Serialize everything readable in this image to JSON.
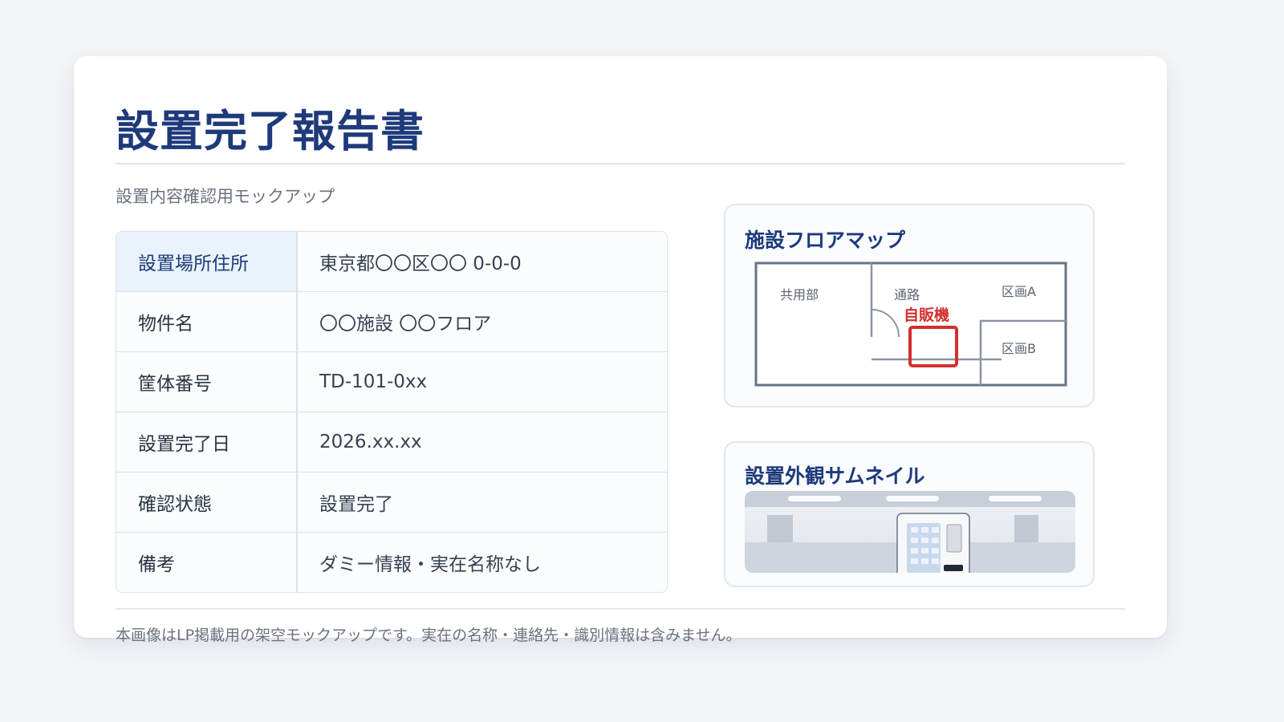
{
  "report": {
    "title": "設置完了報告書",
    "subtitle": "設置内容確認用モックアップ",
    "rows": [
      {
        "label": "設置場所住所",
        "value": "東京都〇〇区〇〇 0-0-0"
      },
      {
        "label": "物件名",
        "value": "〇〇施設 〇〇フロア"
      },
      {
        "label": "筐体番号",
        "value": "TD-101-0xx"
      },
      {
        "label": "設置完了日",
        "value": "2026.xx.xx"
      },
      {
        "label": "確認状態",
        "value": "設置完了"
      },
      {
        "label": "備考",
        "value": "ダミー情報・実在名称なし"
      }
    ]
  },
  "floor_map": {
    "title": "施設フロアマップ",
    "labels": {
      "common": "共用部",
      "aisle": "通路",
      "zone_a": "区画A",
      "zone_b": "区画B",
      "vending": "自販機"
    },
    "colors": {
      "wall": "#667386",
      "marker": "#d32f2f"
    }
  },
  "thumbnail": {
    "title": "設置外観サムネイル"
  },
  "footnote": "本画像はLP掲載用の架空モックアップです。実在の名称・連絡先・識別情報は含みません。",
  "colors": {
    "accent": "#1e3a7b",
    "highlight_bg": "#eaf2fb"
  }
}
